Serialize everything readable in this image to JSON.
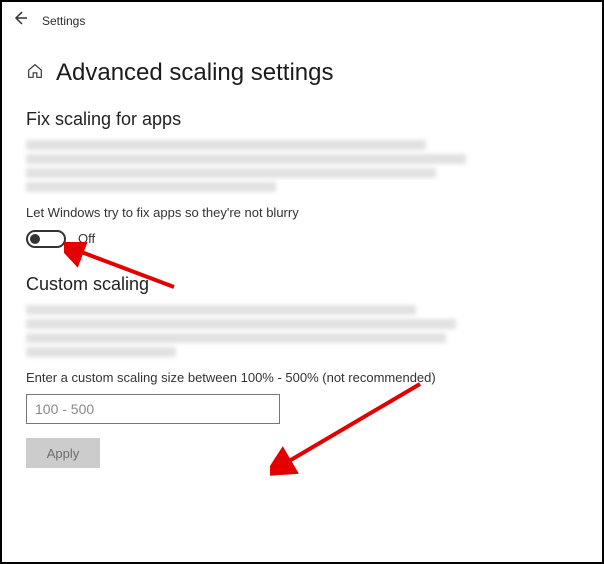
{
  "header": {
    "app_title": "Settings"
  },
  "page": {
    "title": "Advanced scaling settings"
  },
  "section1": {
    "heading": "Fix scaling for apps",
    "toggle_label": "Let Windows try to fix apps so they're not blurry",
    "toggle_state": "Off"
  },
  "section2": {
    "heading": "Custom scaling",
    "input_label": "Enter a custom scaling size between 100% - 500% (not recommended)",
    "input_placeholder": "100 - 500",
    "apply_label": "Apply"
  }
}
